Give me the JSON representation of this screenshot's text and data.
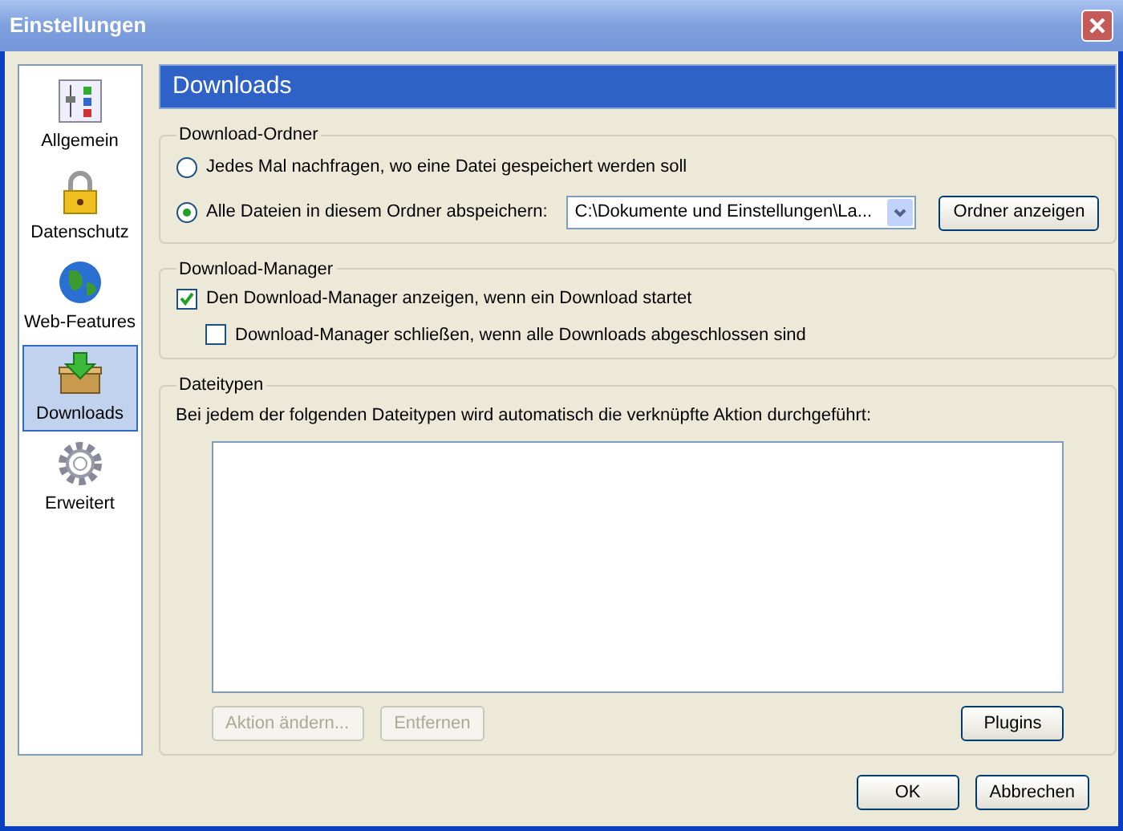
{
  "window": {
    "title": "Einstellungen"
  },
  "sidebar": {
    "items": [
      {
        "label": "Allgemein",
        "kind": "sliders",
        "selected": false
      },
      {
        "label": "Datenschutz",
        "kind": "lock",
        "selected": false
      },
      {
        "label": "Web-Features",
        "kind": "globe",
        "selected": false
      },
      {
        "label": "Downloads",
        "kind": "box",
        "selected": true
      },
      {
        "label": "Erweitert",
        "kind": "gear",
        "selected": false
      }
    ]
  },
  "panel": {
    "title": "Downloads"
  },
  "download_folder": {
    "title": "Download-Ordner",
    "options": [
      {
        "label": "Jedes Mal nachfragen, wo eine Datei gespeichert werden soll",
        "selected": false
      },
      {
        "label": "Alle Dateien in diesem Ordner abspeichern:",
        "selected": true
      }
    ],
    "folder": "C:\\Dokumente und Einstellungen\\La...",
    "show_button": "Ordner anzeigen"
  },
  "download_manager": {
    "title": "Download-Manager",
    "options": [
      {
        "label": "Den Download-Manager anzeigen, wenn ein Download startet",
        "checked": true
      },
      {
        "label": "Download-Manager schließen, wenn alle Downloads abgeschlossen sind",
        "checked": false
      }
    ]
  },
  "file_types": {
    "title": "Dateitypen",
    "description": "Bei jedem der folgenden Dateitypen wird automatisch die verknüpfte Aktion durchgeführt:",
    "buttons": [
      {
        "label": "Aktion ändern...",
        "disabled": true
      },
      {
        "label": "Entfernen",
        "disabled": true
      }
    ],
    "plugins_button": "Plugins"
  },
  "buttons": [
    "OK",
    "Abbrechen"
  ]
}
